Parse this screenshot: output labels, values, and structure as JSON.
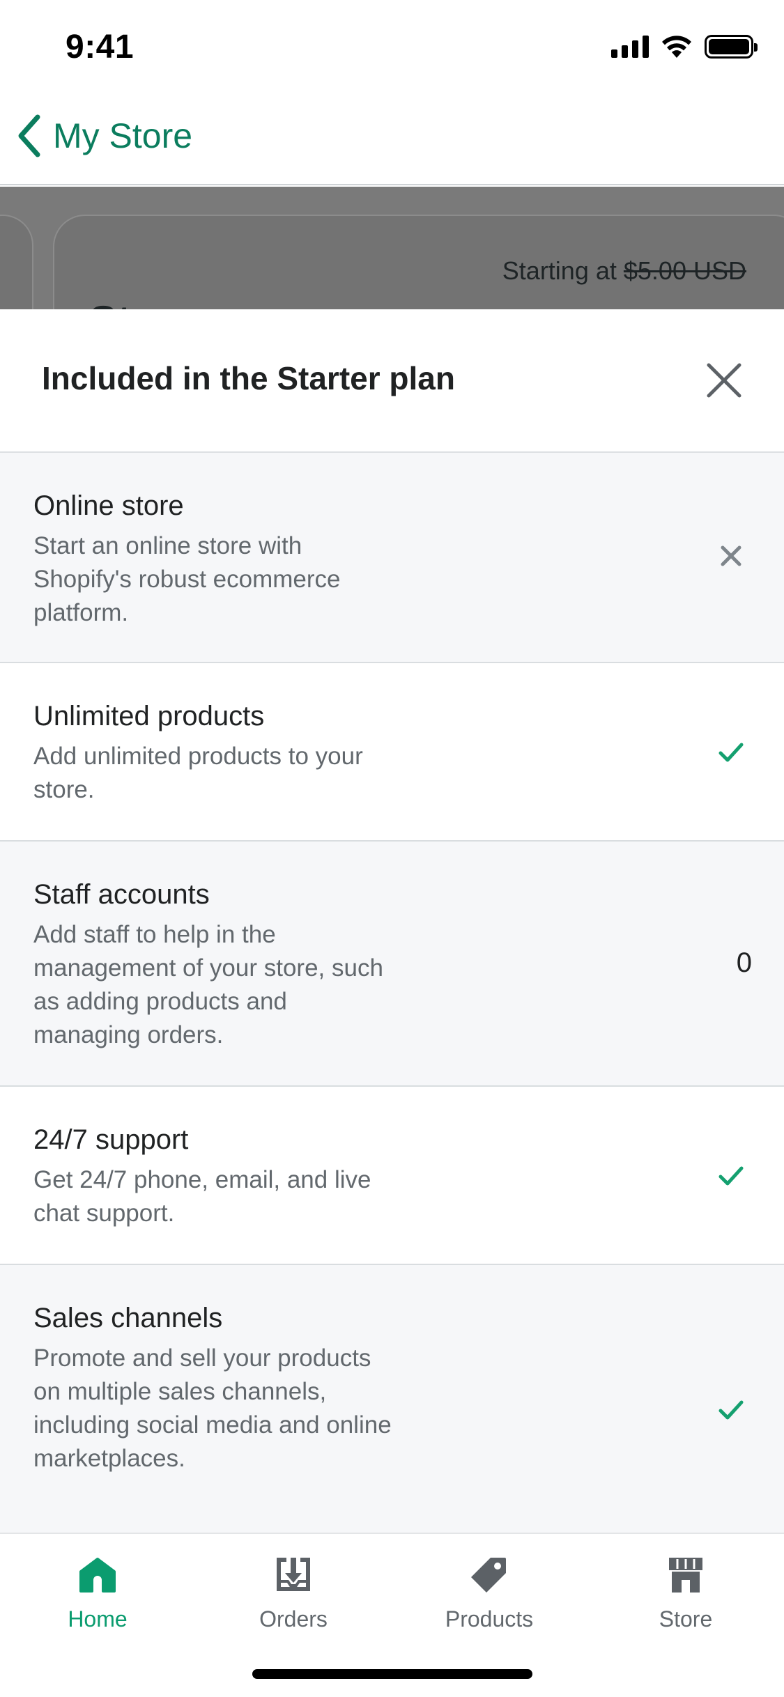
{
  "status_bar": {
    "time": "9:41"
  },
  "nav": {
    "back_label": "My Store"
  },
  "background_card": {
    "price_prefix": "Starting at",
    "price_struck": "$5.00 USD",
    "title_peek": "St"
  },
  "sheet": {
    "title": "Included in the Starter plan",
    "rows": [
      {
        "title": "Online store",
        "description": "Start an online store with Shopify's robust ecommerce platform.",
        "status": "not-included-icon"
      },
      {
        "title": "Unlimited products",
        "description": "Add unlimited products to your store.",
        "status": "checkmark-icon"
      },
      {
        "title": "Staff accounts",
        "description": "Add staff to help in the management of your store, such as adding products and managing orders.",
        "value": "0"
      },
      {
        "title": "24/7 support",
        "description": "Get 24/7 phone, email, and live chat support.",
        "status": "checkmark-icon"
      },
      {
        "title": "Sales channels",
        "description": "Promote and sell your products on multiple sales channels, including social media and online marketplaces.",
        "status": "checkmark-icon"
      }
    ]
  },
  "tab_bar": {
    "tabs": [
      {
        "label": "Home",
        "icon": "home-icon",
        "active": true
      },
      {
        "label": "Orders",
        "icon": "orders-icon",
        "active": false
      },
      {
        "label": "Products",
        "icon": "tag-icon",
        "active": false
      },
      {
        "label": "Store",
        "icon": "store-icon",
        "active": false
      }
    ]
  },
  "colors": {
    "accent": "#0b7d5e",
    "active_tab": "#0b9c6f",
    "check": "#14a06f",
    "muted": "#62686d"
  }
}
